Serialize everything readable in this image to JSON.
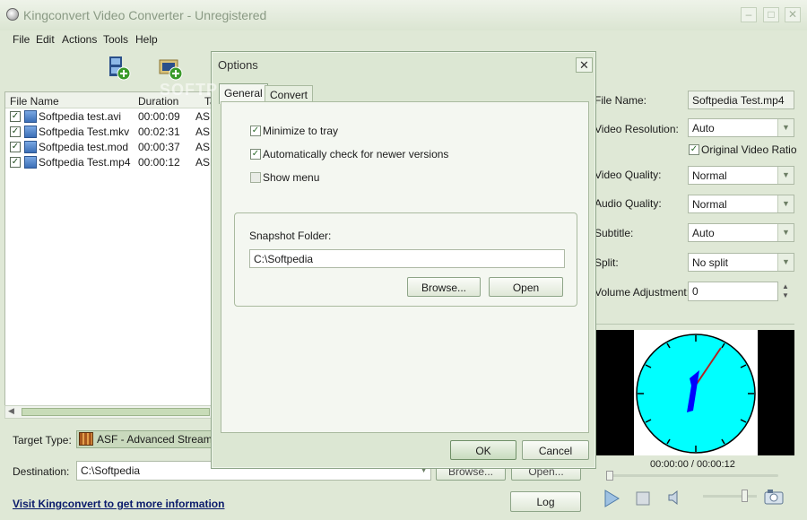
{
  "window": {
    "title": "Kingconvert Video Converter - Unregistered",
    "min_label": "–",
    "max_label": "□",
    "close_label": "✕"
  },
  "menu": [
    "File",
    "Edit",
    "Actions",
    "Tools",
    "Help"
  ],
  "toolbar": {
    "add_video_icon": "film-add-icon",
    "add_folder_icon": "folder-add-icon"
  },
  "file_list": {
    "headers": [
      "File Name",
      "Duration",
      "Ta"
    ],
    "rows": [
      {
        "name": "Softpedia test.avi",
        "duration": "00:00:09",
        "type": "ASF"
      },
      {
        "name": "Softpedia Test.mkv",
        "duration": "00:02:31",
        "type": "ASF"
      },
      {
        "name": "Softpedia test.mod",
        "duration": "00:00:37",
        "type": "ASF"
      },
      {
        "name": "Softpedia Test.mp4",
        "duration": "00:00:12",
        "type": "ASF"
      }
    ]
  },
  "bottom": {
    "target_type_label": "Target Type:",
    "target_type_value": "ASF - Advanced Streaming",
    "destination_label": "Destination:",
    "destination_value": "C:\\Softpedia",
    "browse_label": "Browse...",
    "open_label": "Open...",
    "log_label": "Log",
    "link_text": "Visit Kingconvert to get more information"
  },
  "right_panel": {
    "file_name_label": "File Name:",
    "file_name_value": "Softpedia Test.mp4",
    "video_resolution_label": "Video Resolution:",
    "video_resolution_value": "Auto",
    "original_ratio_label": "Original Video Ratio",
    "video_quality_label": "Video Quality:",
    "video_quality_value": "Normal",
    "audio_quality_label": "Audio Quality:",
    "audio_quality_value": "Normal",
    "subtitle_label": "Subtitle:",
    "subtitle_value": "Auto",
    "split_label": "Split:",
    "split_value": "No split",
    "volume_label": "Volume Adjustment:",
    "volume_value": "0",
    "time_readout": "00:00:00 / 00:00:12"
  },
  "dialog": {
    "title": "Options",
    "close_label": "✕",
    "tabs": [
      "General",
      "Convert"
    ],
    "options": [
      {
        "label": "Minimize to tray",
        "checked": true
      },
      {
        "label": "Automatically check for newer versions",
        "checked": true
      },
      {
        "label": "Show menu",
        "checked": false
      }
    ],
    "snapshot_label": "Snapshot Folder:",
    "snapshot_value": "C:\\Softpedia",
    "browse_label": "Browse...",
    "open_label": "Open",
    "ok_label": "OK",
    "cancel_label": "Cancel"
  },
  "watermark": "SOFTPEDIA",
  "colors": {
    "accent": "#8ea588",
    "clock_face": "#00ffff",
    "clock_hand": "#0000ff",
    "clock_second": "#b22222"
  }
}
